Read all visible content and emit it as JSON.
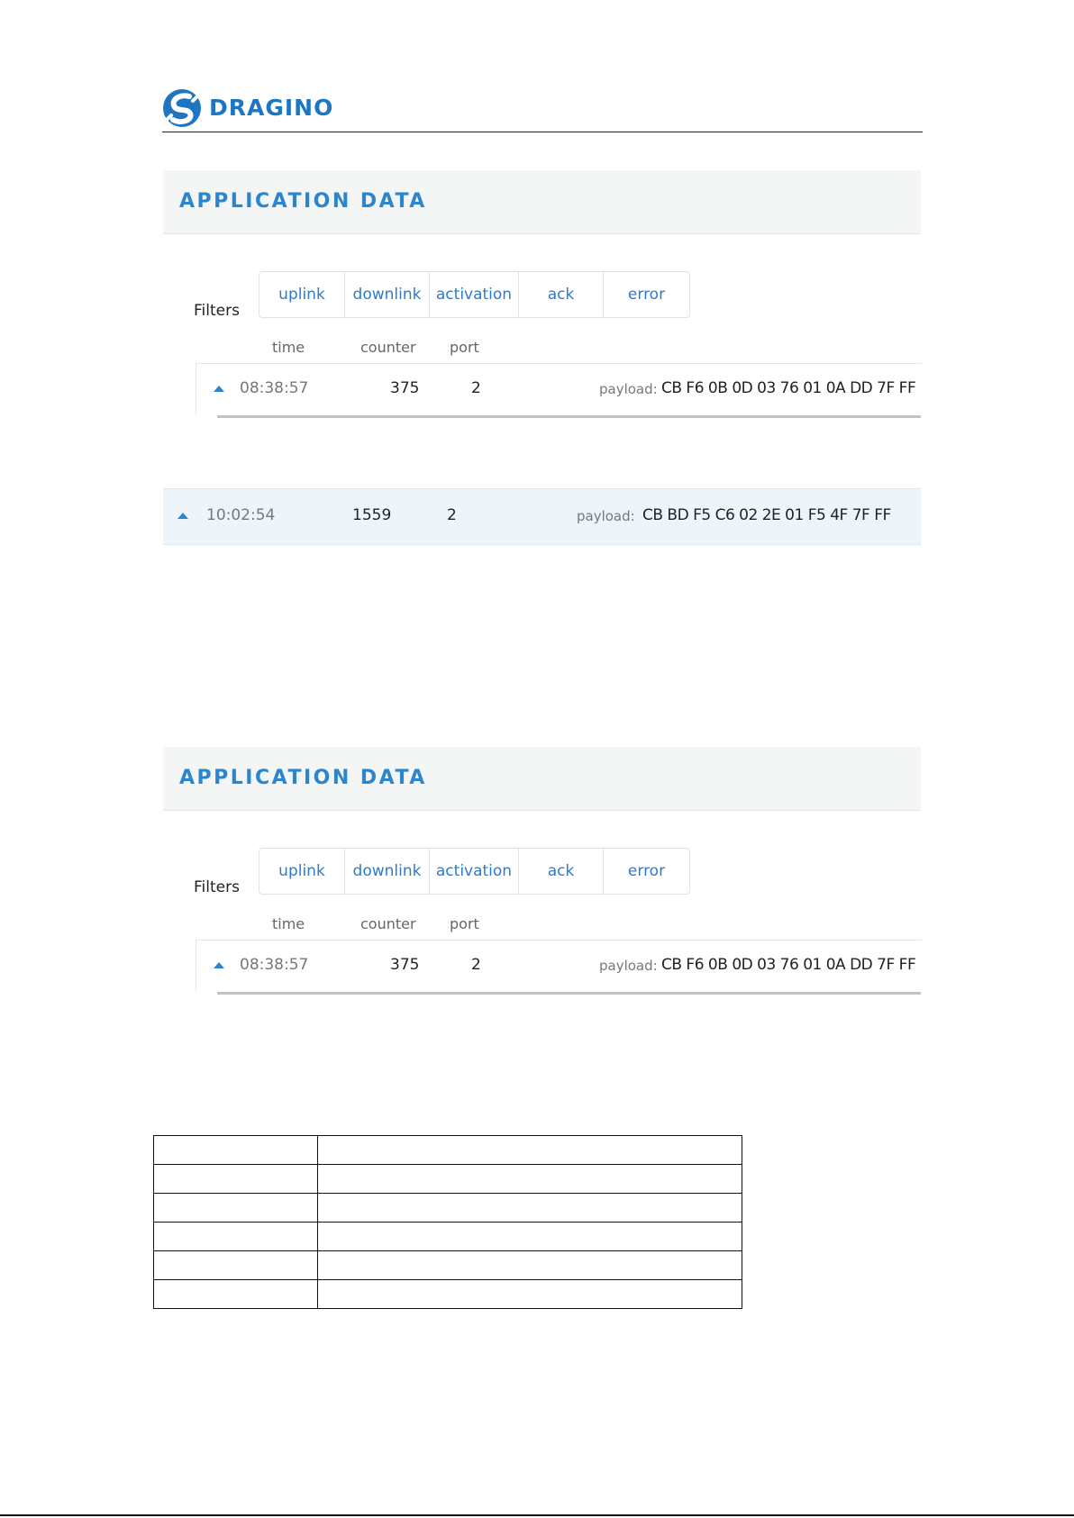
{
  "header": {
    "brand": "DRAGINO",
    "brand_color": "#1e76c3"
  },
  "panels": [
    {
      "title": "APPLICATION DATA",
      "filters_label": "Filters",
      "filters": [
        "uplink",
        "downlink",
        "activation",
        "ack",
        "error"
      ],
      "columns": {
        "time": "time",
        "counter": "counter",
        "port": "port"
      },
      "row": {
        "time": "08:38:57",
        "counter": "375",
        "port": "2",
        "payload_label": "payload:",
        "payload": "CB F6 0B 0D 03 76 01 0A DD 7F FF"
      }
    },
    {
      "title": "APPLICATION DATA",
      "filters_label": "Filters",
      "filters": [
        "uplink",
        "downlink",
        "activation",
        "ack",
        "error"
      ],
      "columns": {
        "time": "time",
        "counter": "counter",
        "port": "port"
      },
      "row": {
        "time": "08:38:57",
        "counter": "375",
        "port": "2",
        "payload_label": "payload:",
        "payload": "CB F6 0B 0D 03 76 01 0A DD 7F FF"
      }
    }
  ],
  "strip_row": {
    "time": "10:02:54",
    "counter": "1559",
    "port": "2",
    "payload_label": "payload:",
    "payload": "CB BD F5 C6 02 2E 01 F5 4F 7F FF"
  },
  "accent_color": "#2b86cf"
}
